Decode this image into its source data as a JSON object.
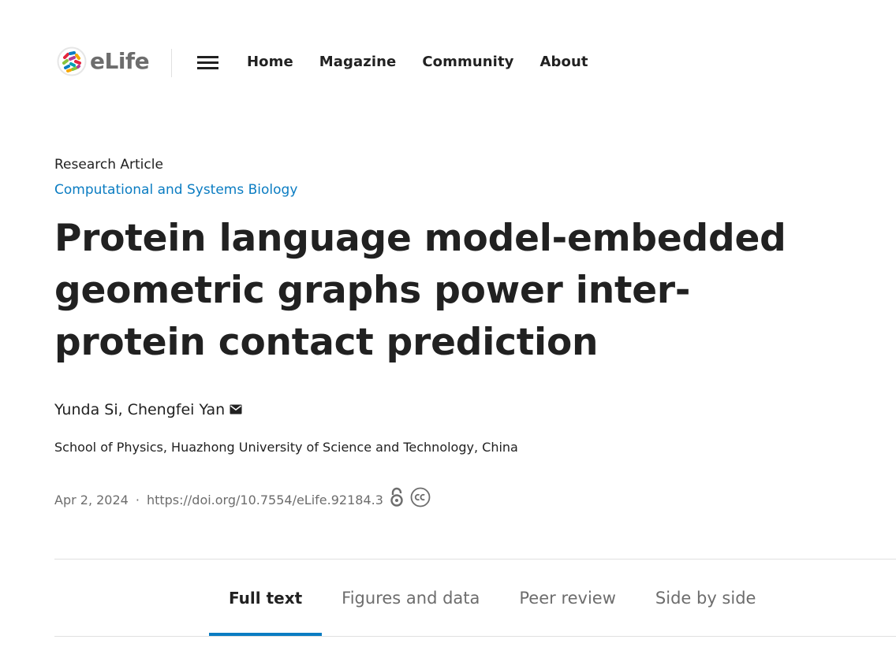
{
  "header": {
    "logo_text": "eLife",
    "menu_icon": "hamburger-menu-icon",
    "nav": [
      {
        "label": "Home"
      },
      {
        "label": "Magazine"
      },
      {
        "label": "Community"
      },
      {
        "label": "About"
      }
    ]
  },
  "article": {
    "type": "Research Article",
    "subject": "Computational and Systems Biology",
    "title": "Protein language model-embedded geometric graphs power inter-protein contact prediction",
    "authors": "Yunda Si, Chengfei Yan",
    "affiliation": "School of Physics, Huazhong University of Science and Technology, China",
    "date": "Apr 2, 2024",
    "separator": "·",
    "doi": "https://doi.org/10.7554/eLife.92184.3",
    "icons": [
      "mail-icon",
      "open-access-icon",
      "creative-commons-icon"
    ]
  },
  "tabs": [
    {
      "label": "Full text",
      "active": true
    },
    {
      "label": "Figures and data",
      "active": false
    },
    {
      "label": "Peer review",
      "active": false
    },
    {
      "label": "Side by side",
      "active": false
    }
  ],
  "colors": {
    "accent": "#0a7cc2",
    "text": "#212121",
    "muted": "#6d6d6d",
    "divider": "#e0e0e0"
  }
}
